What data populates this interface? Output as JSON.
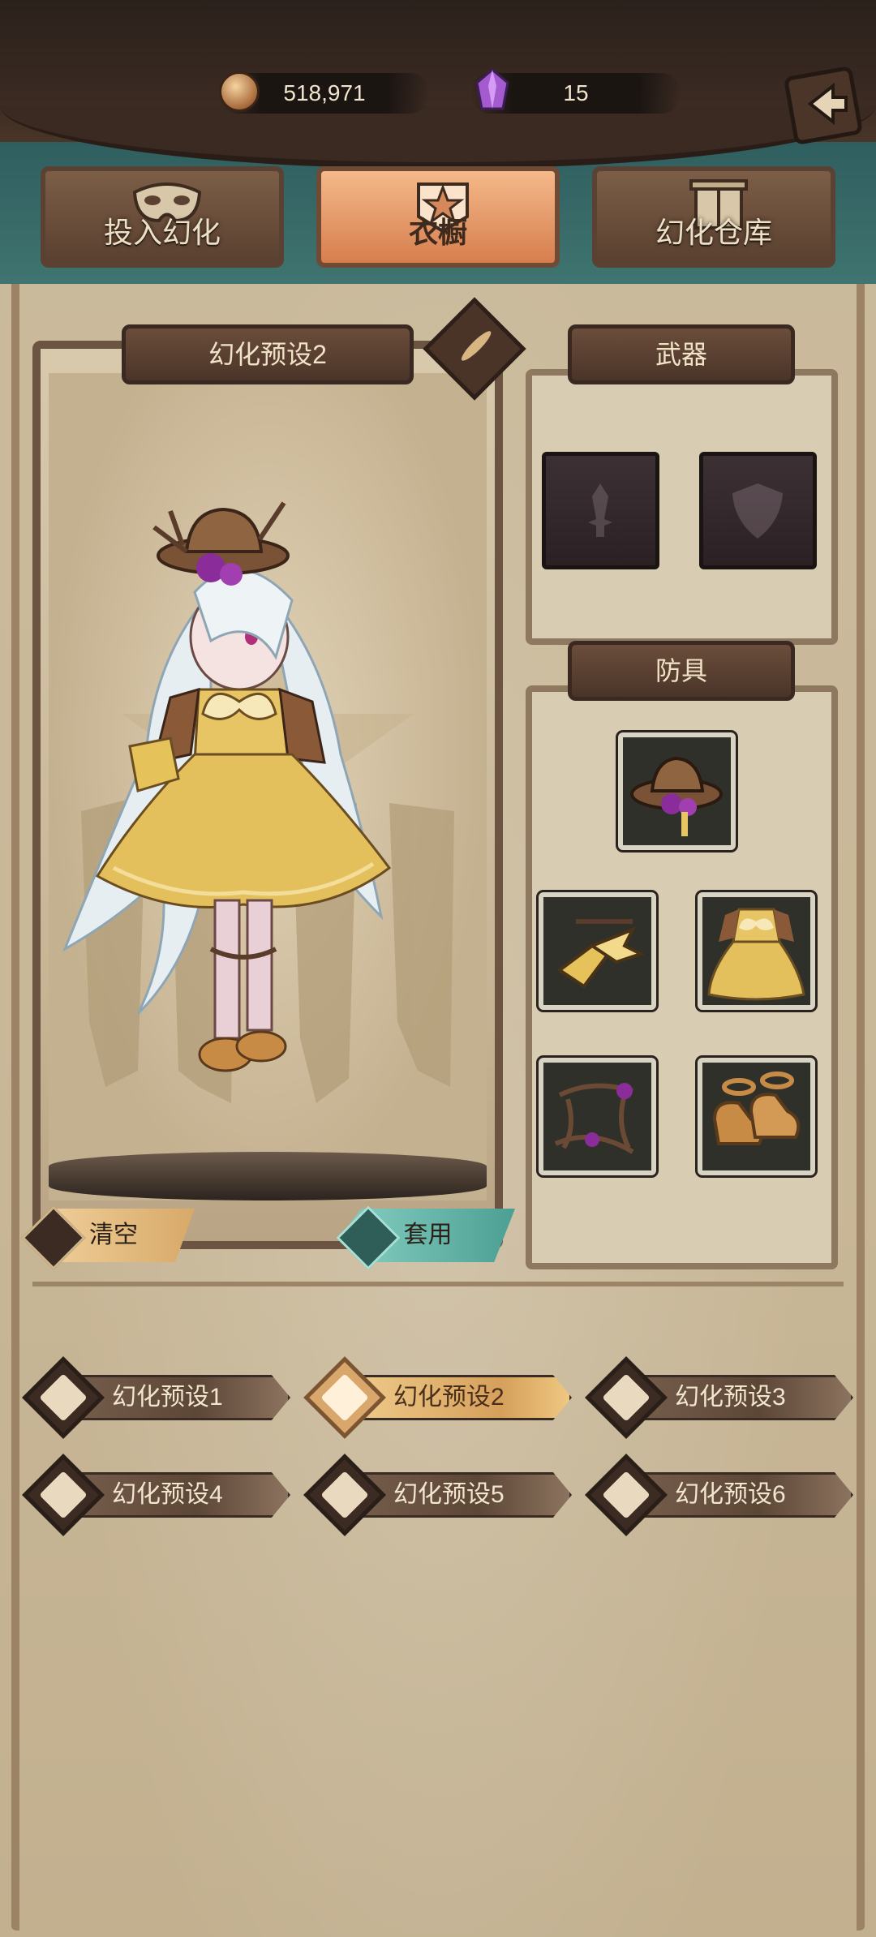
{
  "currency": {
    "gold": "518,971",
    "gems": "15",
    "gold_icon": "coin-icon",
    "gem_icon": "purple-crystal-icon"
  },
  "nav": {
    "back_icon": "back-arrow-icon",
    "tabs": [
      {
        "label": "投入幻化",
        "icon": "mask-icon",
        "active": false
      },
      {
        "label": "衣橱",
        "icon": "wardrobe-crest-icon",
        "active": true
      },
      {
        "label": "幻化仓库",
        "icon": "warehouse-icon",
        "active": false
      }
    ]
  },
  "preview": {
    "title": "幻化预设2",
    "edit_icon": "quill-icon",
    "clear_label": "清空",
    "apply_label": "套用"
  },
  "equipment": {
    "weapon_title": "武器",
    "armor_title": "防具",
    "weapon_slots": [
      "sword-slot-icon",
      "shield-slot-icon"
    ],
    "armor_slots": [
      "hat-item",
      "gauntlet-item",
      "dress-item",
      "thorn-accessory-item",
      "shoes-item"
    ]
  },
  "presets": [
    {
      "label": "幻化预设1",
      "active": false
    },
    {
      "label": "幻化预设2",
      "active": true
    },
    {
      "label": "幻化预设3",
      "active": false
    },
    {
      "label": "幻化预设4",
      "active": false
    },
    {
      "label": "幻化预设5",
      "active": false
    },
    {
      "label": "幻化预设6",
      "active": false
    }
  ],
  "colors": {
    "active_tab": "#e9a06f",
    "apply_button": "#6bb8ab",
    "clear_button": "#e4be82",
    "active_preset": "#e0b06c"
  }
}
